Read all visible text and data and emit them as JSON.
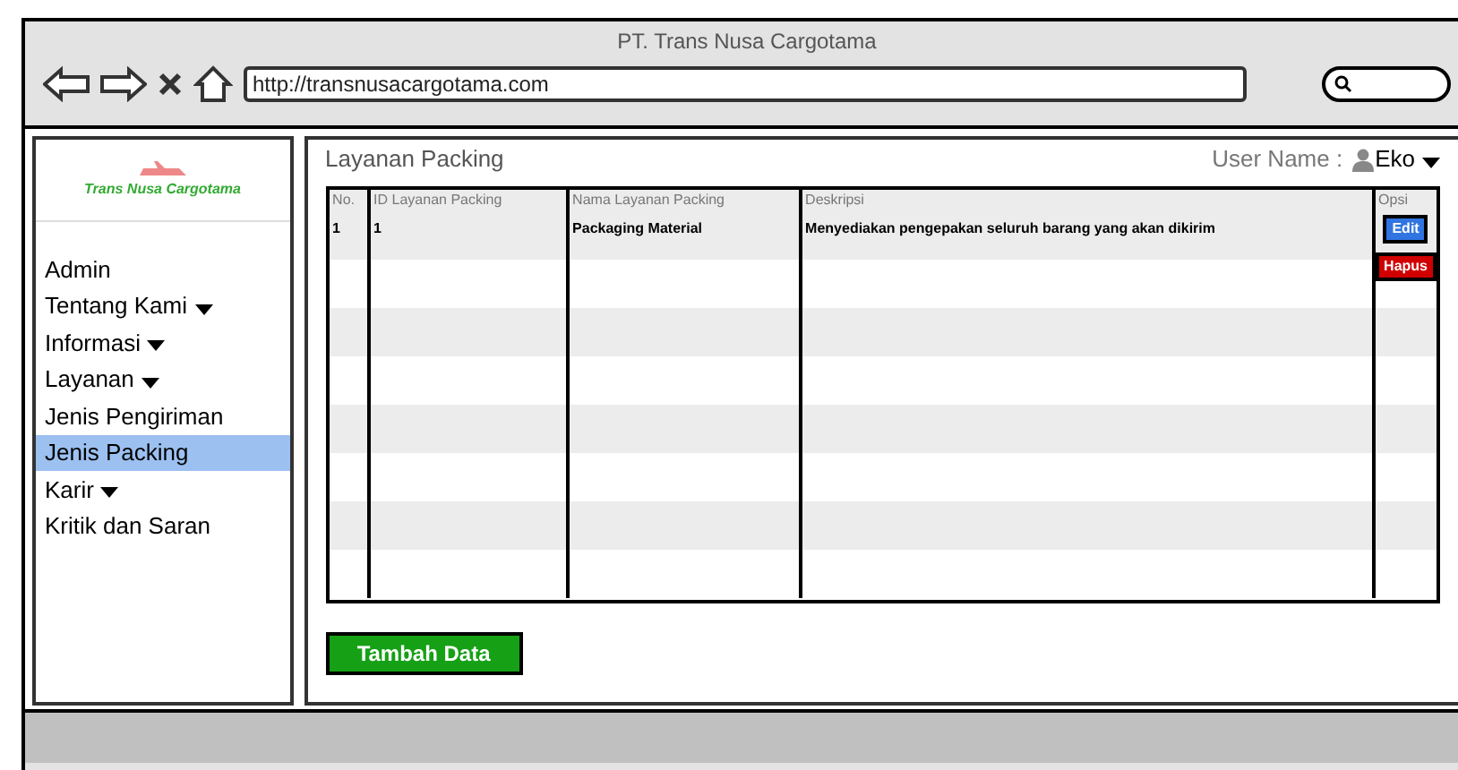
{
  "window": {
    "title": "PT. Trans Nusa Cargotama",
    "url": "http://transnusacargotama.com"
  },
  "logo": {
    "name": "Trans Nusa Cargotama"
  },
  "sidebar": {
    "items": [
      {
        "label": "Admin",
        "dropdown": false,
        "selected": false
      },
      {
        "label": "Tentang Kami",
        "dropdown": true,
        "selected": false
      },
      {
        "label": "Informasi",
        "dropdown": true,
        "selected": false
      },
      {
        "label": "Layanan",
        "dropdown": true,
        "selected": false
      },
      {
        "label": "Jenis Pengiriman",
        "dropdown": false,
        "selected": false
      },
      {
        "label": "Jenis Packing",
        "dropdown": false,
        "selected": true
      },
      {
        "label": "Karir",
        "dropdown": true,
        "selected": false
      },
      {
        "label": "Kritik dan Saran",
        "dropdown": false,
        "selected": false
      }
    ]
  },
  "panel": {
    "title": "Layanan Packing",
    "user_label": "User Name :",
    "user_name": "Eko"
  },
  "table": {
    "columns": [
      "No.",
      "ID Layanan Packing",
      "Nama Layanan Packing",
      "Deskripsi",
      "Opsi"
    ],
    "rows": [
      {
        "cells": [
          "1",
          "1",
          "Packaging Material",
          "Menyediakan pengepakan seluruh barang yang akan dikirim"
        ],
        "actions": [
          {
            "kind": "edit",
            "label": "Edit"
          },
          {
            "kind": "delete",
            "label": "Hapus"
          }
        ]
      }
    ]
  },
  "add_button": "Tambah Data"
}
